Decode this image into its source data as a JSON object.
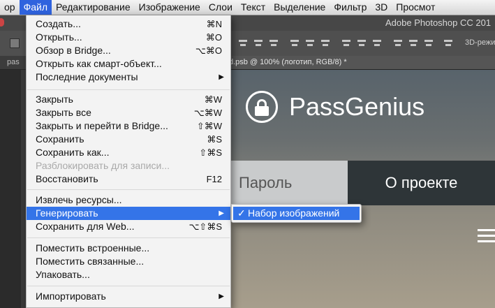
{
  "menubar": {
    "items": [
      "оp",
      "Файл",
      "Редактирование",
      "Изображение",
      "Слои",
      "Текст",
      "Выделение",
      "Фильтр",
      "3D",
      "Просмот"
    ]
  },
  "app": {
    "title": "Adobe Photoshop CC 201"
  },
  "optionsbar": {
    "mode_label": "3D-режи"
  },
  "tabs": {
    "left": "pas",
    "active": "d.psb @ 100% (логотип, RGB/8) *"
  },
  "canvas": {
    "brand": "PassGenius",
    "nav": [
      "Пароль",
      "О проекте"
    ]
  },
  "file_menu": {
    "items": [
      {
        "label": "Создать...",
        "shortcut": "⌘N"
      },
      {
        "label": "Открыть...",
        "shortcut": "⌘O"
      },
      {
        "label": "Обзор в Bridge...",
        "shortcut": "⌥⌘O"
      },
      {
        "label": "Открыть как смарт-объект...",
        "shortcut": ""
      },
      {
        "label": "Последние документы",
        "shortcut": ""
      },
      {
        "label": "Закрыть",
        "shortcut": "⌘W"
      },
      {
        "label": "Закрыть все",
        "shortcut": "⌥⌘W"
      },
      {
        "label": "Закрыть и перейти в Bridge...",
        "shortcut": "⇧⌘W"
      },
      {
        "label": "Сохранить",
        "shortcut": "⌘S"
      },
      {
        "label": "Сохранить как...",
        "shortcut": "⇧⌘S"
      },
      {
        "label": "Разблокировать для записи...",
        "shortcut": ""
      },
      {
        "label": "Восстановить",
        "shortcut": "F12"
      },
      {
        "label": "Извлечь ресурсы...",
        "shortcut": ""
      },
      {
        "label": "Генерировать",
        "shortcut": ""
      },
      {
        "label": "Сохранить для Web...",
        "shortcut": "⌥⇧⌘S"
      },
      {
        "label": "Поместить встроенные...",
        "shortcut": ""
      },
      {
        "label": "Поместить связанные...",
        "shortcut": ""
      },
      {
        "label": "Упаковать...",
        "shortcut": ""
      },
      {
        "label": "Импортировать",
        "shortcut": ""
      }
    ]
  },
  "submenu": {
    "check": "✓",
    "label": "Набор изображений"
  }
}
